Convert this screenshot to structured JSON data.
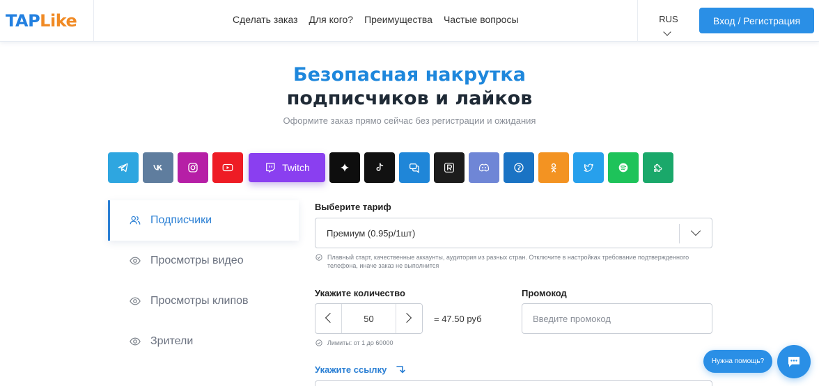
{
  "header": {
    "logo_part1": "TAP",
    "logo_part2": "Like",
    "nav": [
      "Сделать заказ",
      "Для кого?",
      "Преимущества",
      "Частые вопросы"
    ],
    "lang": "RUS",
    "login_label": "Вход / Регистрация"
  },
  "hero": {
    "title_line1": "Безопасная накрутка",
    "title_line2": "подписчиков и лайков",
    "subtitle": "Оформите заказ прямо сейчас без регистрации и ожидания"
  },
  "socials": [
    {
      "name": "telegram",
      "icon": "telegram-icon",
      "color": "#2ea6e0"
    },
    {
      "name": "vk",
      "icon": "vk-icon",
      "color": "#5f7d9e"
    },
    {
      "name": "instagram",
      "icon": "instagram-icon",
      "color": "#b61fa6"
    },
    {
      "name": "youtube",
      "icon": "youtube-icon",
      "color": "#ee1c25"
    },
    {
      "name": "twitch",
      "icon": "twitch-icon",
      "color": "#8a3ff0",
      "label": "Twitch"
    },
    {
      "name": "threads",
      "icon": "sparkle-icon",
      "color": "#0e0e0e"
    },
    {
      "name": "tiktok",
      "icon": "tiktok-icon",
      "color": "#111111"
    },
    {
      "name": "likee",
      "icon": "chat-icon",
      "color": "#1f86d8"
    },
    {
      "name": "rutube",
      "icon": "rutube-icon",
      "color": "#1c1c1c"
    },
    {
      "name": "discord",
      "icon": "discord-icon",
      "color": "#6f86d6"
    },
    {
      "name": "yappy",
      "icon": "yappy-icon",
      "color": "#1a73c4"
    },
    {
      "name": "odnoklassniki",
      "icon": "ok-icon",
      "color": "#f39322"
    },
    {
      "name": "twitter",
      "icon": "twitter-icon",
      "color": "#27a0ec"
    },
    {
      "name": "spotify",
      "icon": "spotify-icon",
      "color": "#1ec35a"
    },
    {
      "name": "zen",
      "icon": "puzzle-icon",
      "color": "#1aa86a"
    }
  ],
  "menu": [
    {
      "label": "Подписчики",
      "icon": "users-icon",
      "active": true
    },
    {
      "label": "Просмотры видео",
      "icon": "eye-icon"
    },
    {
      "label": "Просмотры клипов",
      "icon": "eye-icon"
    },
    {
      "label": "Зрители",
      "icon": "eye-icon"
    }
  ],
  "form": {
    "tariff_label": "Выберите тариф",
    "tariff_value": "Премиум (0.95р/1шт)",
    "tariff_note": "Плавный старт, качественные аккаунты, аудитория из разных стран. Отключите в настройках требование подтвержденного телефона, иначе заказ не выполнится",
    "quantity_label": "Укажите количество",
    "quantity_value": "50",
    "price": "= 47.50 руб",
    "limits_note": "Лимиты: от 1 до 60000",
    "promo_label": "Промокод",
    "promo_placeholder": "Введите промокод",
    "link_label": "Укажите ссылку"
  },
  "help": {
    "pill_label": "Нужна помощь?"
  },
  "colors": {
    "accent": "#2a8fe6",
    "logo_blue": "#2380e0",
    "logo_orange": "#f08a24"
  }
}
